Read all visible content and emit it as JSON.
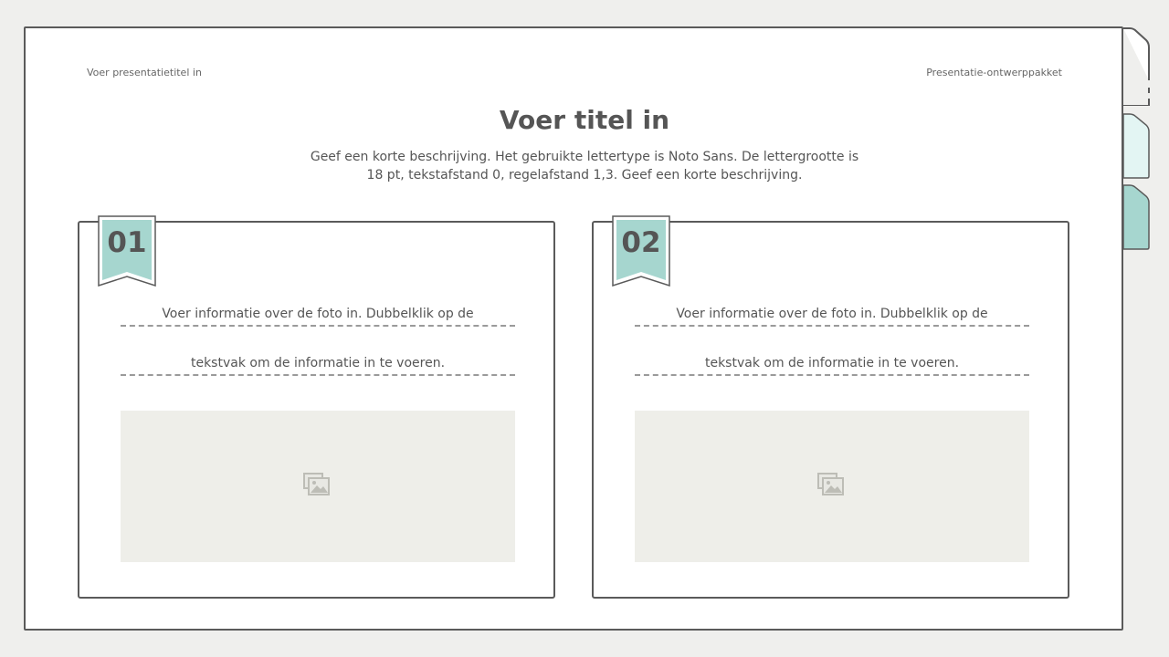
{
  "header": {
    "presentation_title": "Voer presentatietitel in",
    "design_pack": "Presentatie-ontwerppakket"
  },
  "slide": {
    "title": "Voer titel in",
    "subtitle": "Geef een korte beschrijving. Het gebruikte lettertype is Noto Sans. De lettergrootte is 18 pt, tekstafstand 0, regelafstand 1,3. Geef een korte beschrijving."
  },
  "cards": [
    {
      "number": "01",
      "info_line1": "Voer informatie over de foto in. Dubbelklik op de",
      "info_line2": "tekstvak om de informatie in te voeren.",
      "photo_icon": "image-placeholder-icon"
    },
    {
      "number": "02",
      "info_line1": "Voer informatie over de foto in. Dubbelklik op de",
      "info_line2": "tekstvak om de informatie in te voeren.",
      "photo_icon": "image-placeholder-icon"
    }
  ],
  "colors": {
    "accent_teal": "#a6d6cf",
    "accent_teal_light": "#e3f5f3",
    "border_gray": "#5a5a5a",
    "photo_bg": "#eeeee9",
    "page_bg": "#efefed"
  }
}
